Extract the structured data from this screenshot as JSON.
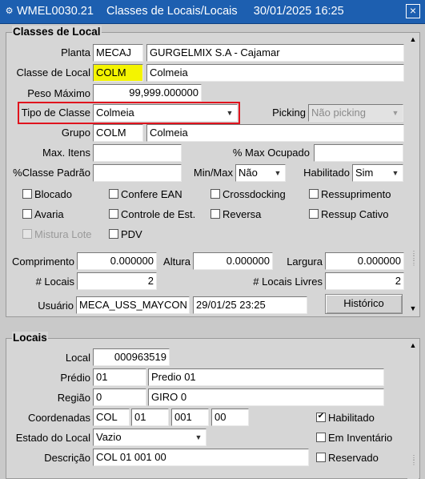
{
  "window": {
    "title": "WMEL0030.21    Classes de Locais/Locais     30/01/2025 16:25",
    "close_symbol": "×"
  },
  "classes_de_local": {
    "section_title": "Classes de Local",
    "planta": {
      "label": "Planta",
      "code": "MECAJ",
      "name": "GURGELMIX S.A - Cajamar"
    },
    "classe_de_local": {
      "label": "Classe de Local",
      "code": "COLM",
      "name": "Colmeia"
    },
    "peso_maximo": {
      "label": "Peso Máximo",
      "value": "99,999.000000"
    },
    "tipo_de_classe": {
      "label": "Tipo de Classe",
      "value": "Colmeia"
    },
    "picking": {
      "label": "Picking",
      "value": "Não picking"
    },
    "grupo": {
      "label": "Grupo",
      "code": "COLM",
      "name": "Colmeia"
    },
    "max_itens": {
      "label": "Max. Itens",
      "value": ""
    },
    "pct_max_ocupado": {
      "label": "% Max Ocupado",
      "value": ""
    },
    "pct_classe_padrao": {
      "label": "%Classe Padrão",
      "value": ""
    },
    "min_max": {
      "label": "Min/Max",
      "value": "Não"
    },
    "habilitado": {
      "label": "Habilitado",
      "value": "Sim"
    },
    "checkboxes": {
      "blocado": "Blocado",
      "confere_ean": "Confere EAN",
      "crossdocking": "Crossdocking",
      "ressuprimento": "Ressuprimento",
      "avaria": "Avaria",
      "controle_est": "Controle de Est.",
      "reversa": "Reversa",
      "ressup_cativo": "Ressup Cativo",
      "mistura_lote": "Mistura Lote",
      "pdv": "PDV"
    },
    "comprimento": {
      "label": "Comprimento",
      "value": "0.000000"
    },
    "altura": {
      "label": "Altura",
      "value": "0.000000"
    },
    "largura": {
      "label": "Largura",
      "value": "0.000000"
    },
    "num_locais": {
      "label": "# Locais",
      "value": "2"
    },
    "num_locais_livres": {
      "label": "# Locais Livres",
      "value": "2"
    },
    "usuario": {
      "label": "Usuário",
      "value": "MECA_USS_MAYCON",
      "date": "29/01/25 23:25"
    },
    "historico_button": "Histórico"
  },
  "locais": {
    "section_title": "Locais",
    "local": {
      "label": "Local",
      "value": "000963519"
    },
    "predio": {
      "label": "Prédio",
      "code": "01",
      "name": "Predio 01"
    },
    "regiao": {
      "label": "Região",
      "code": "0",
      "name": "GIRO 0"
    },
    "coordenadas": {
      "label": "Coordenadas",
      "values": [
        "COL",
        "01",
        "001",
        "00"
      ]
    },
    "estado_do_local": {
      "label": "Estado do Local",
      "value": "Vazio"
    },
    "descricao": {
      "label": "Descrição",
      "value": "COL 01 001 00"
    },
    "habilitado": {
      "label": "Habilitado",
      "checked": true,
      "check_symbol": "✔"
    },
    "em_inventario": {
      "label": "Em Inventário"
    },
    "reservado": {
      "label": "Reservado"
    }
  },
  "icons": {
    "app": "oracle-forms-icon",
    "dropdown": "▼",
    "scroll_up": "▲",
    "scroll_down": "▼"
  }
}
